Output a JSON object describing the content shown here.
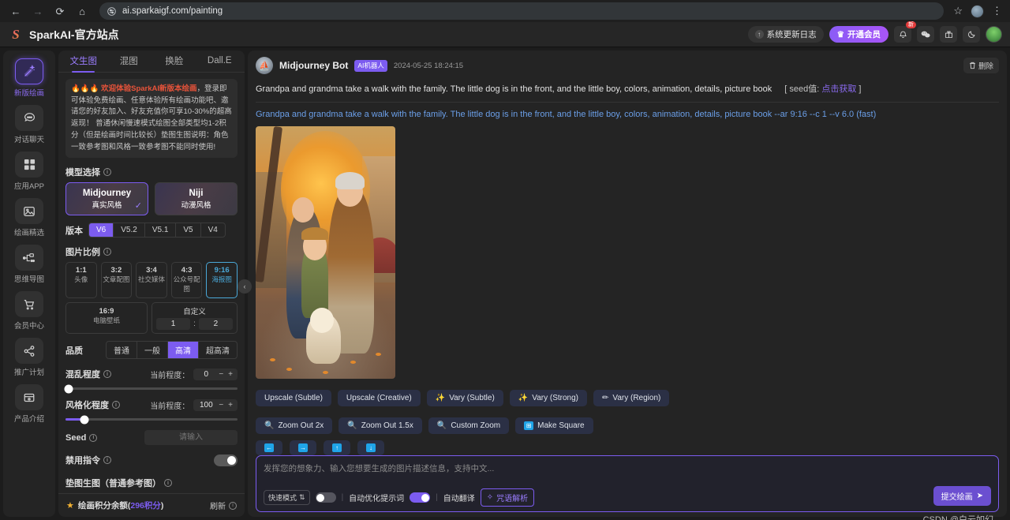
{
  "browser": {
    "back_icon": "←",
    "forward_icon": "→",
    "reload_icon": "⟳",
    "home_icon": "⌂",
    "site_settings_icon": "tune-icon",
    "url": "ai.sparkaigf.com/painting",
    "bookmark_icon": "☆",
    "menu_icon": "⋮"
  },
  "header": {
    "logo_text": "S",
    "title": "SparkAI-官方站点",
    "update_log": "系统更新日志",
    "update_icon": "↑",
    "vip": "开通会员",
    "vip_icon": "♛",
    "bell_icon": "🔔",
    "bell_badge": "新",
    "wechat_icon": "wechat-icon",
    "gift_icon": "gift-icon",
    "moon_icon": "moon-icon"
  },
  "rail": {
    "items": [
      {
        "label": "新版绘画",
        "icon": "magic-wand-icon",
        "active": true
      },
      {
        "label": "对话聊天",
        "icon": "chat-bubble-icon",
        "active": false
      },
      {
        "label": "应用APP",
        "icon": "grid-apps-icon",
        "active": false
      },
      {
        "label": "绘画精选",
        "icon": "image-icon",
        "active": false
      },
      {
        "label": "思维导图",
        "icon": "mindmap-icon",
        "active": false
      },
      {
        "label": "会员中心",
        "icon": "cart-icon",
        "active": false
      },
      {
        "label": "推广计划",
        "icon": "share-icon",
        "active": false
      },
      {
        "label": "产品介绍",
        "icon": "box-icon",
        "active": false
      }
    ]
  },
  "panel": {
    "tabs": [
      {
        "label": "文生图",
        "active": true
      },
      {
        "label": "混图",
        "active": false
      },
      {
        "label": "换脸",
        "active": false
      },
      {
        "label": "Dall.E",
        "active": false
      }
    ],
    "notice_hot": "🔥🔥🔥 欢迎体验SparkAI新版本绘画",
    "notice_text": "，登录即可体验免费绘画、任意体验所有绘画功能吧、邀请您的好友加入、好友充值你可享10-30%的超高返现！ 普通休闲慢速模式绘图全部类型均1-2积分（但是绘画时间比较长）垫图生图说明：角色一致参考图和风格一致参考图不能同时使用!",
    "model_label": "模型选择",
    "models": [
      {
        "title": "Midjourney",
        "sub": "真实风格",
        "selected": true
      },
      {
        "title": "Niji",
        "sub": "动漫风格",
        "selected": false
      }
    ],
    "model_check": "✓",
    "version_label": "版本",
    "versions": [
      {
        "label": "V6",
        "on": true
      },
      {
        "label": "V5.2",
        "on": false
      },
      {
        "label": "V5.1",
        "on": false
      },
      {
        "label": "V5",
        "on": false
      },
      {
        "label": "V4",
        "on": false
      }
    ],
    "ratio_label": "图片比例",
    "ratios": [
      {
        "r": "1:1",
        "name": "头像",
        "on": false
      },
      {
        "r": "3:2",
        "name": "文章配图",
        "on": false
      },
      {
        "r": "3:4",
        "name": "社交媒体",
        "on": false
      },
      {
        "r": "4:3",
        "name": "公众号配图",
        "on": false
      },
      {
        "r": "9:16",
        "name": "海报图",
        "on": true
      }
    ],
    "ratio_wide": {
      "r": "16:9",
      "name": "电脑壁纸"
    },
    "custom_label": "自定义",
    "custom_w": "1",
    "custom_h": "2",
    "custom_colon": ":",
    "quality_label": "品质",
    "qualities": [
      {
        "label": "普通",
        "on": false
      },
      {
        "label": "一般",
        "on": false
      },
      {
        "label": "高清",
        "on": true
      },
      {
        "label": "超高清",
        "on": false
      }
    ],
    "chaos_label": "混乱程度",
    "chaos_cur_label": "当前程度：",
    "chaos_value": "0",
    "chaos_minus": "−",
    "chaos_plus": "+",
    "chaos_percent": 0,
    "stylize_label": "风格化程度",
    "stylize_cur_label": "当前程度：",
    "stylize_value": "100",
    "stylize_minus": "−",
    "stylize_plus": "+",
    "stylize_percent": 10,
    "seed_label": "Seed",
    "seed_placeholder": "请输入",
    "seed_value": "",
    "noinstr_label": "禁用指令",
    "noinstr_on": false,
    "ref_label": "垫图生图（普通参考图）",
    "credits_text": "绘画积分余额(",
    "credits_value": "296积分",
    "credits_suffix": ")",
    "refresh": "刷新",
    "star_icon": "★",
    "collapse_icon": "‹"
  },
  "message": {
    "bot_name": "Midjourney Bot",
    "bot_tag": "AI机器人",
    "time": "2024-05-25 18:24:15",
    "delete_label": "删除",
    "delete_icon": "🗑",
    "prompt": "Grandpa and grandma take a walk with the family. The little dog is in the front, and the little boy, colors, animation, details, picture book",
    "seed_prefix": "[ seed值: ",
    "seed_link": "点击获取",
    "seed_suffix": " ]",
    "prompt_echo": "Grandpa and grandma take a walk with the family. The little dog is in the front, and the little boy, colors, animation, details, picture book --ar 9:16 --c 1 --v 6.0  (fast)",
    "image_alt": "pixar-style-autumn-family-walk"
  },
  "actions": {
    "row1": [
      {
        "label": "Upscale (Subtle)",
        "icon": ""
      },
      {
        "label": "Upscale (Creative)",
        "icon": ""
      },
      {
        "label": "Vary (Subtle)",
        "icon": "✨"
      },
      {
        "label": "Vary (Strong)",
        "icon": "✨"
      },
      {
        "label": "Vary (Region)",
        "icon": "✏"
      }
    ],
    "row2": [
      {
        "label": "Zoom Out 2x",
        "icon": "🔍"
      },
      {
        "label": "Zoom Out 1.5x",
        "icon": "🔍"
      },
      {
        "label": "Custom Zoom",
        "icon": "🔍"
      },
      {
        "label": "Make Square",
        "icon": "⊞"
      }
    ],
    "row3": [
      {
        "icon": "←",
        "name": "pan-left"
      },
      {
        "icon": "→",
        "name": "pan-right"
      },
      {
        "icon": "↑",
        "name": "pan-up"
      },
      {
        "icon": "↓",
        "name": "pan-down"
      }
    ]
  },
  "composer": {
    "placeholder": "发挥您的想象力、输入您想要生成的图片描述信息，支持中文...",
    "value": "",
    "mode_pill": "快速模式",
    "mode_pill_icon": "⇅",
    "optimize_label": "自动优化提示词",
    "optimize_on": false,
    "translate_label": "自动翻译",
    "translate_on": true,
    "spell_label": "咒语解析",
    "spell_icon": "✧",
    "submit_label": "提交绘画",
    "submit_icon": "➤",
    "separator": "|"
  },
  "watermark": "CSDN @白云如幻",
  "colors": {
    "accent": "#7c5cf0",
    "link": "#6b9fe8",
    "notice_hot": "#e8533a",
    "ratio_selected": "#4aa8d8",
    "badge_red": "#e23b3b"
  }
}
